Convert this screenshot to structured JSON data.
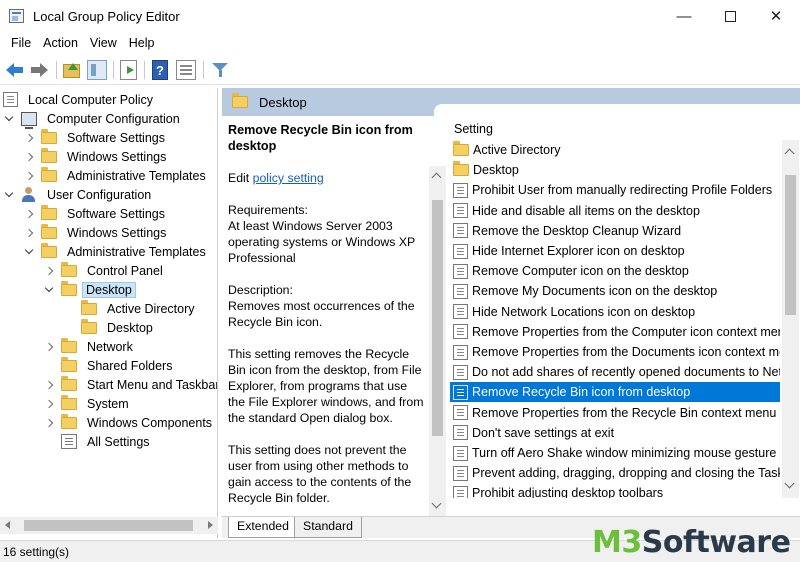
{
  "window": {
    "title": "Local Group Policy Editor"
  },
  "menu": [
    "File",
    "Action",
    "View",
    "Help"
  ],
  "tree": {
    "root": "Local Computer Policy",
    "computer_config": "Computer Configuration",
    "cc_children": [
      "Software Settings",
      "Windows Settings",
      "Administrative Templates"
    ],
    "user_config": "User Configuration",
    "uc_children": [
      "Software Settings",
      "Windows Settings",
      "Administrative Templates"
    ],
    "at_children": [
      "Control Panel",
      "Desktop"
    ],
    "desktop_children": [
      "Active Directory",
      "Desktop"
    ],
    "at_after": [
      "Network",
      "Shared Folders",
      "Start Menu and Taskbar",
      "System",
      "Windows Components",
      "All Settings"
    ]
  },
  "pane": {
    "header": "Desktop"
  },
  "description": {
    "title": "Remove Recycle Bin icon from desktop",
    "edit_prefix": "Edit",
    "edit_link": "policy setting",
    "requirements_label": "Requirements:",
    "requirements_text": "At least Windows Server 2003 operating systems or Windows XP Professional",
    "description_label": "Description:",
    "description_text": "Removes most occurrences of the Recycle Bin icon.",
    "para2": "This setting removes the Recycle Bin icon from the desktop, from File Explorer, from programs that use the File Explorer windows, and from the standard Open dialog box.",
    "para3": "This setting does not prevent the user from using other methods to gain access to the contents of the Recycle Bin folder."
  },
  "settings": {
    "column_header": "Setting",
    "items": [
      {
        "label": "Active Directory",
        "type": "folder"
      },
      {
        "label": "Desktop",
        "type": "folder"
      },
      {
        "label": "Prohibit User from manually redirecting Profile Folders",
        "type": "policy"
      },
      {
        "label": "Hide and disable all items on the desktop",
        "type": "policy"
      },
      {
        "label": "Remove the Desktop Cleanup Wizard",
        "type": "policy"
      },
      {
        "label": "Hide Internet Explorer icon on desktop",
        "type": "policy"
      },
      {
        "label": "Remove Computer icon on the desktop",
        "type": "policy"
      },
      {
        "label": "Remove My Documents icon on the desktop",
        "type": "policy"
      },
      {
        "label": "Hide Network Locations icon on desktop",
        "type": "policy"
      },
      {
        "label": "Remove Properties from the Computer icon context menu",
        "type": "policy"
      },
      {
        "label": "Remove Properties from the Documents icon context menu",
        "type": "policy"
      },
      {
        "label": "Do not add shares of recently opened documents to Network Locations",
        "type": "policy"
      },
      {
        "label": "Remove Recycle Bin icon from desktop",
        "type": "policy",
        "selected": true
      },
      {
        "label": "Remove Properties from the Recycle Bin context menu",
        "type": "policy"
      },
      {
        "label": "Don't save settings at exit",
        "type": "policy"
      },
      {
        "label": "Turn off Aero Shake window minimizing mouse gesture",
        "type": "policy"
      },
      {
        "label": "Prevent adding, dragging, dropping and closing the Taskbar's toolbars",
        "type": "policy"
      },
      {
        "label": "Prohibit adjusting desktop toolbars",
        "type": "policy"
      }
    ]
  },
  "tabs": [
    "Extended",
    "Standard"
  ],
  "status": {
    "text": "16 setting(s)"
  },
  "watermark": {
    "part1": "M3",
    "part2": " Software"
  },
  "colors": {
    "selection": "#0078d7",
    "header_bg": "#b7cadf",
    "link": "#1a5fb4"
  }
}
